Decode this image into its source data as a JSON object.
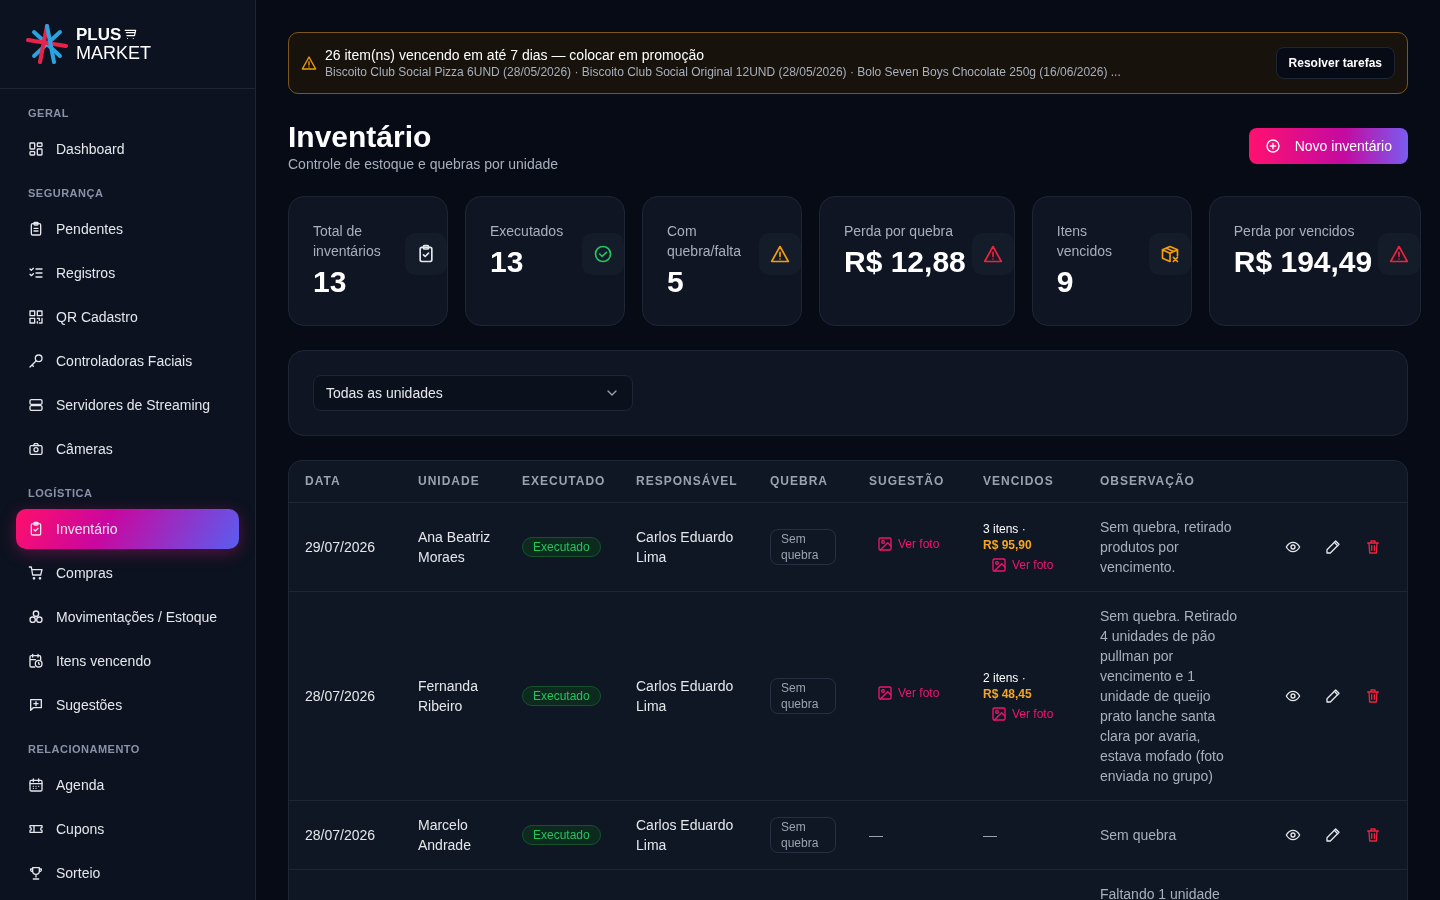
{
  "brand": {
    "line1": "PLUS",
    "line2": "MARKET"
  },
  "sidebar": {
    "sections": [
      {
        "label": "GERAL",
        "items": [
          {
            "label": "Dashboard",
            "selected": false
          }
        ]
      },
      {
        "label": "SEGURANÇA",
        "items": [
          {
            "label": "Pendentes",
            "selected": false
          },
          {
            "label": "Registros",
            "selected": false
          },
          {
            "label": "QR Cadastro",
            "selected": false
          },
          {
            "label": "Controladoras Faciais",
            "selected": false
          },
          {
            "label": "Servidores de Streaming",
            "selected": false
          },
          {
            "label": "Câmeras",
            "selected": false
          }
        ]
      },
      {
        "label": "LOGÍSTICA",
        "items": [
          {
            "label": "Inventário",
            "selected": true
          },
          {
            "label": "Compras",
            "selected": false
          },
          {
            "label": "Movimentações / Estoque",
            "selected": false
          },
          {
            "label": "Itens vencendo",
            "selected": false
          },
          {
            "label": "Sugestões",
            "selected": false
          }
        ]
      },
      {
        "label": "RELACIONAMENTO",
        "items": [
          {
            "label": "Agenda",
            "selected": false
          },
          {
            "label": "Cupons",
            "selected": false
          },
          {
            "label": "Sorteio",
            "selected": false
          }
        ]
      }
    ]
  },
  "alert": {
    "title": "26 item(ns) vencendo em até 7 dias — colocar em promoção",
    "detail": "Biscoito Club Social Pizza 6UND (28/05/2026) · Biscoito Club Social Original 12UND (28/05/2026) · Bolo Seven Boys Chocolate 250g (16/06/2026) ...",
    "button": "Resolver tarefas"
  },
  "page": {
    "title": "Inventário",
    "subtitle": "Controle de estoque e quebras por unidade",
    "new_button": "Novo inventário"
  },
  "stats": [
    {
      "label": "Total de inventários",
      "value": "13",
      "color": "#e5e7eb"
    },
    {
      "label": "Executados",
      "value": "13",
      "color": "#22c55e"
    },
    {
      "label": "Com quebra/falta",
      "value": "5",
      "color": "#f59e0b"
    },
    {
      "label": "Perda por quebra",
      "value": "R$ 12,88",
      "color": "#ef233c"
    },
    {
      "label": "Itens vencidos",
      "value": "9",
      "color": "#f59e0b"
    },
    {
      "label": "Perda por vencidos",
      "value": "R$ 194,49",
      "color": "#ef233c"
    }
  ],
  "filter": {
    "value": "Todas as unidades"
  },
  "table": {
    "columns": [
      "DATA",
      "UNIDADE",
      "EXECUTADO",
      "RESPONSÁVEL",
      "QUEBRA",
      "SUGESTÃO",
      "VENCIDOS",
      "OBSERVAÇÃO"
    ],
    "rows": [
      {
        "data": "29/07/2026",
        "unidade": "Ana Beatriz Moraes",
        "executado": "Executado",
        "responsavel": "Carlos Eduardo Lima",
        "quebra": "Sem quebra",
        "sugestao": {
          "kind": "photo",
          "label": "Ver foto"
        },
        "vencidos": {
          "kind": "items",
          "count": "3 itens ·",
          "value": "R$ 95,90",
          "photo": "Ver foto"
        },
        "observacao": "Sem quebra, retirado produtos por vencimento."
      },
      {
        "data": "28/07/2026",
        "unidade": "Fernanda Ribeiro",
        "executado": "Executado",
        "responsavel": "Carlos Eduardo Lima",
        "quebra": "Sem quebra",
        "sugestao": {
          "kind": "photo",
          "label": "Ver foto"
        },
        "vencidos": {
          "kind": "items",
          "count": "2 itens ·",
          "value": "R$ 48,45",
          "photo": "Ver foto"
        },
        "observacao": "Sem quebra. Retirado 4 unidades de pão pullman por vencimento e 1 unidade de queijo prato lanche santa clara por avaria, estava mofado (foto enviada no grupo)"
      },
      {
        "data": "28/07/2026",
        "unidade": "Marcelo Andrade",
        "executado": "Executado",
        "responsavel": "Carlos Eduardo Lima",
        "quebra": "Sem quebra",
        "sugestao": {
          "kind": "none",
          "label": "—"
        },
        "vencidos": {
          "kind": "none",
          "label": "—"
        },
        "observacao": "Sem quebra"
      },
      {
        "observacao": "Faltando 1 unidade"
      }
    ]
  }
}
